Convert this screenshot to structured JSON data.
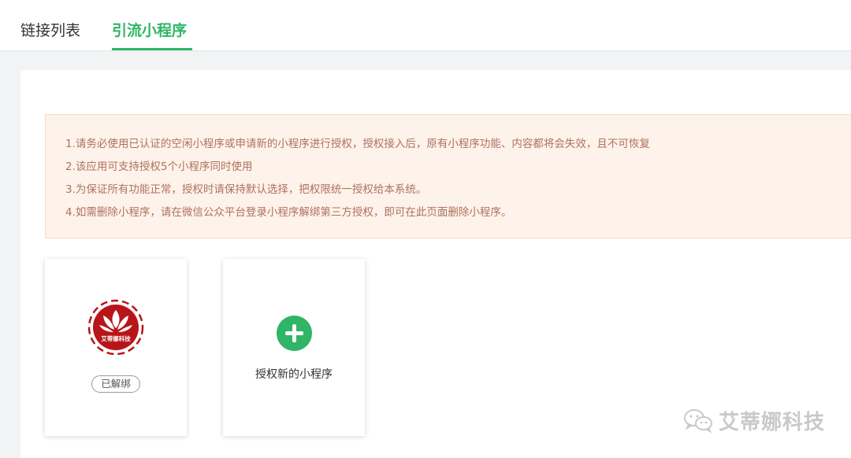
{
  "tabs": [
    {
      "label": "链接列表",
      "active": false
    },
    {
      "label": "引流小程序",
      "active": true
    }
  ],
  "notice": {
    "lines": [
      "1.请务必使用已认证的空闲小程序或申请新的小程序进行授权，授权接入后，原有小程序功能、内容都将会失效，且不可恢复",
      "2.该应用可支持授权5个小程序同时使用",
      "3.为保证所有功能正常，授权时请保持默认选择，把权限统一授权给本系统。",
      "4.如需删除小程序，请在微信公众平台登录小程序解绑第三方授权，即可在此页面删除小程序。"
    ]
  },
  "cards": {
    "bound": {
      "logo_text": "艾蒂娜科技",
      "status": "已解绑",
      "logo_icon": "lotus-logo-icon"
    },
    "add": {
      "label": "授权新的小程序",
      "icon": "plus-circle-icon"
    }
  },
  "watermark": {
    "text": "艾蒂娜科技",
    "icon": "wechat-icon"
  },
  "colors": {
    "accent": "#2fb565",
    "notice_bg": "#fdf3ea",
    "notice_text": "#b0715f",
    "logo_red": "#b8151b"
  }
}
